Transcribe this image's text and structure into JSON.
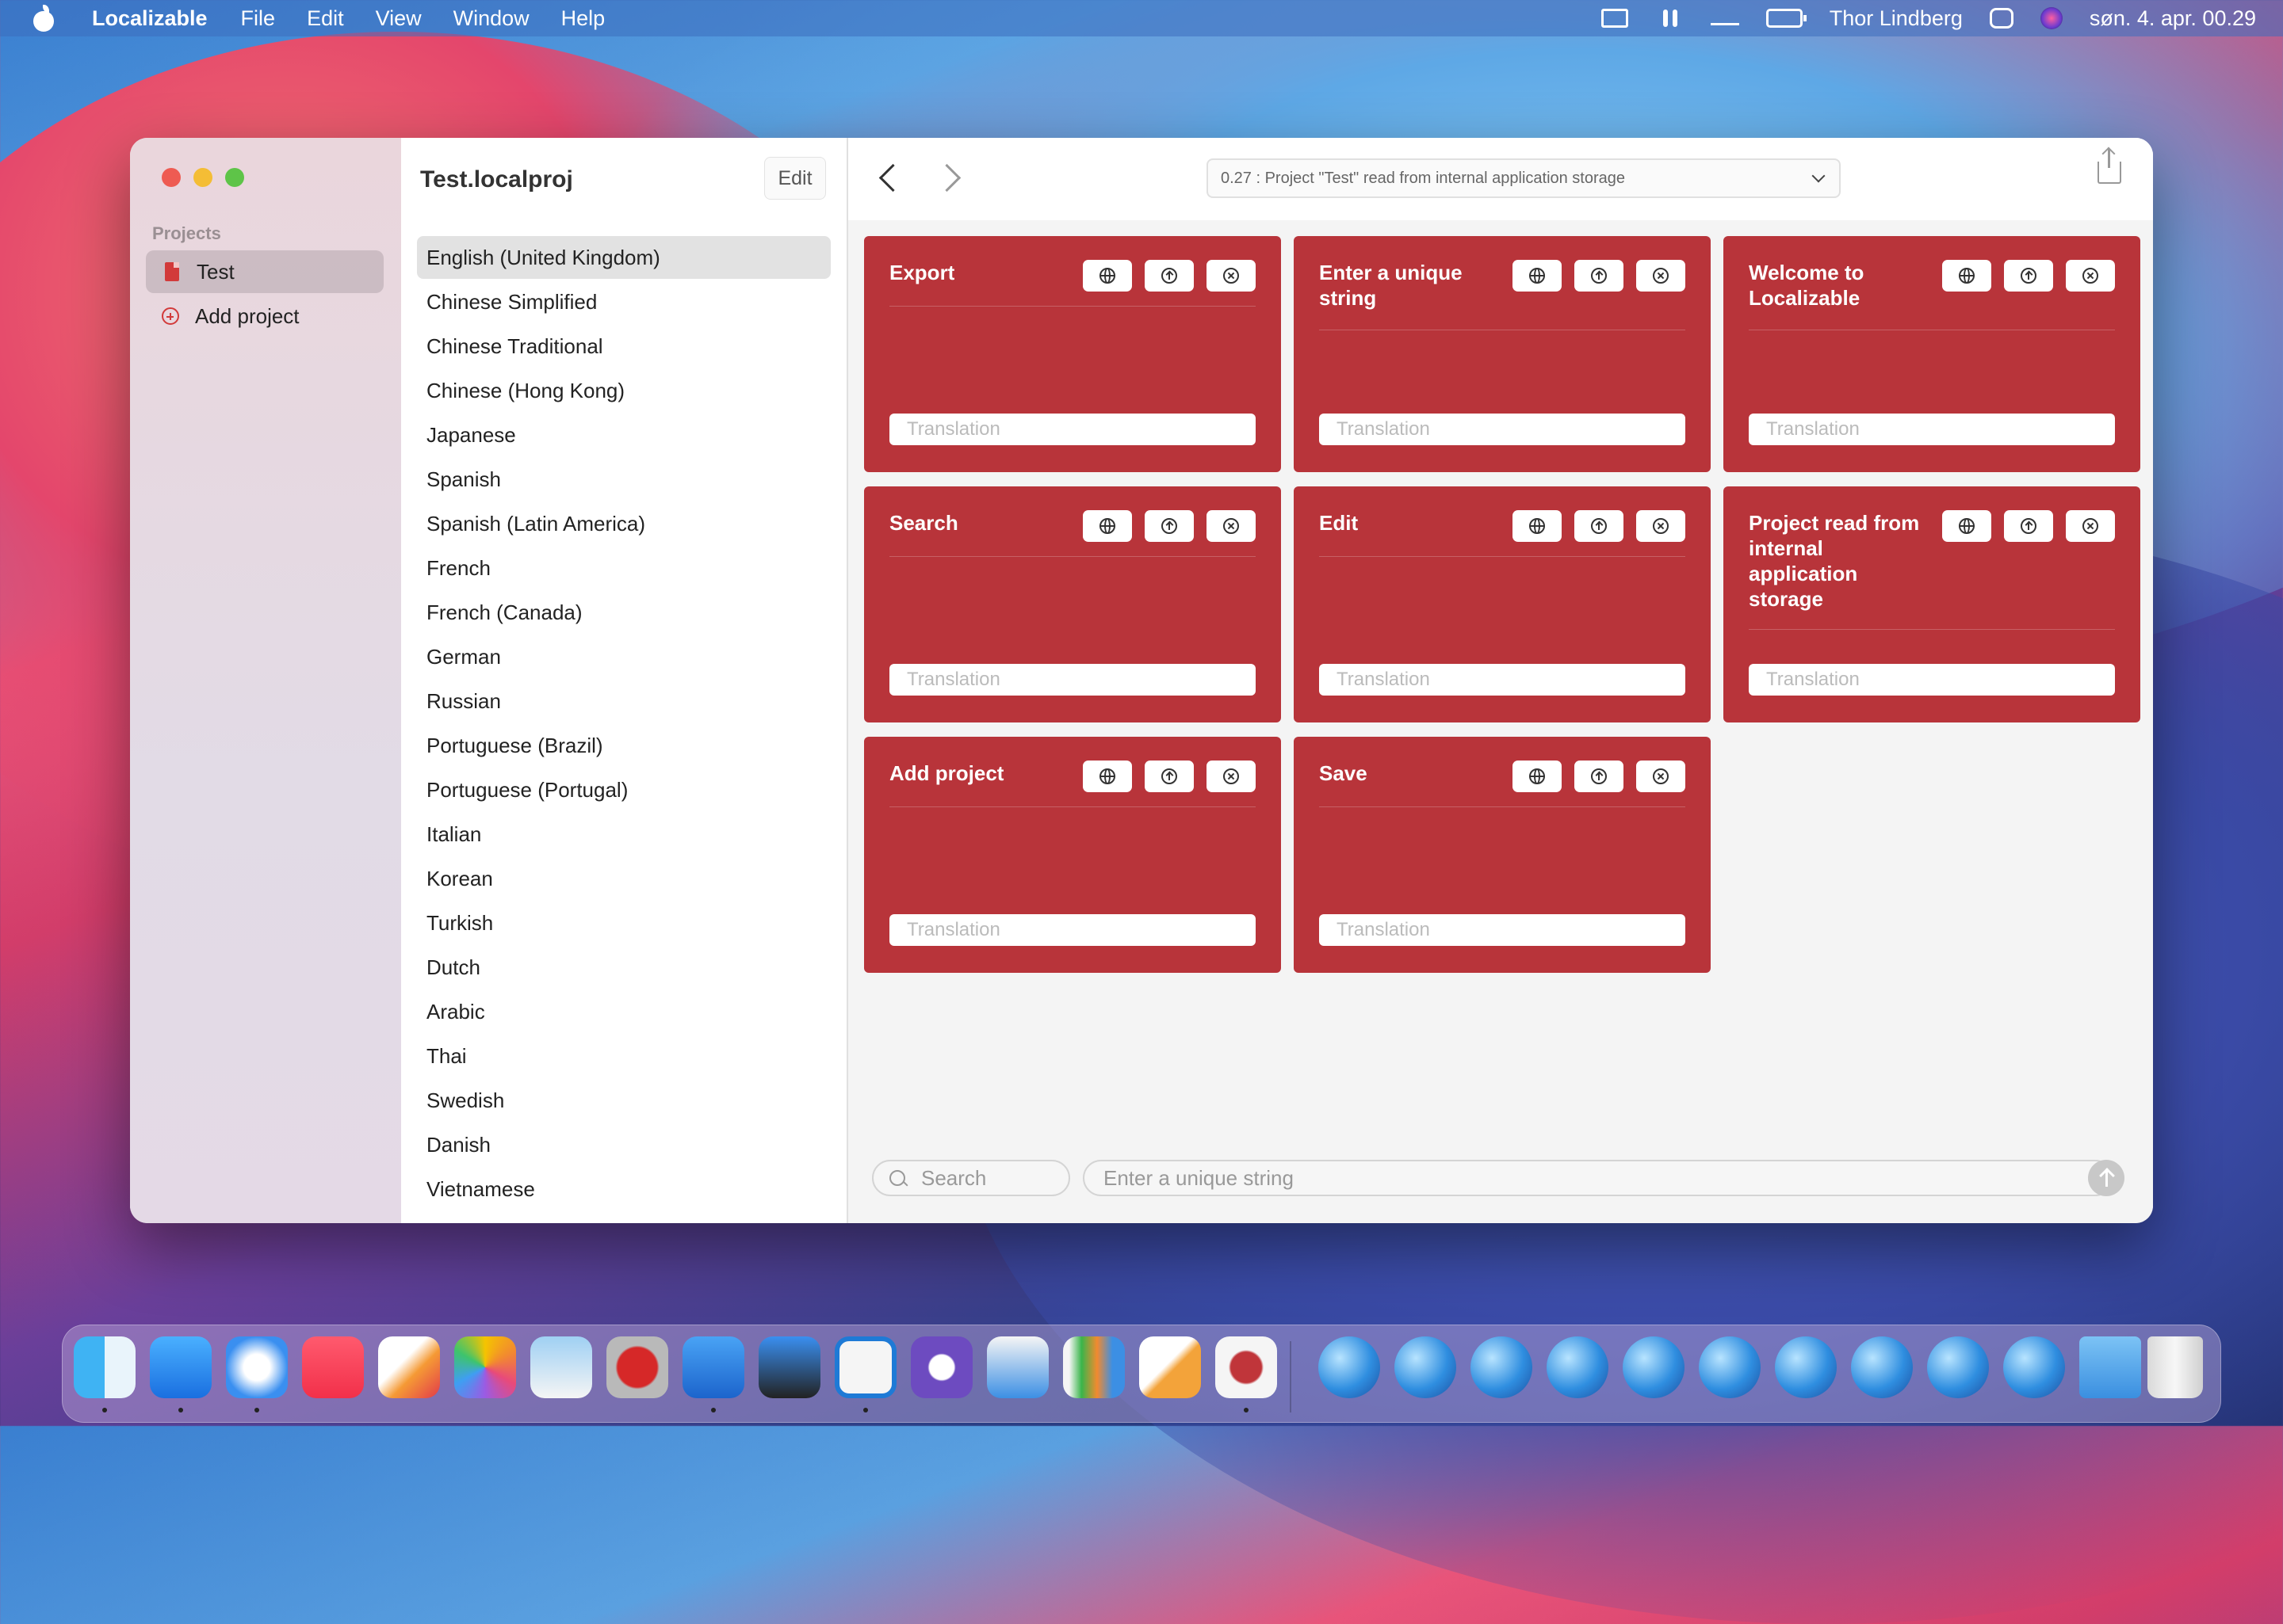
{
  "menubar": {
    "app_name": "Localizable",
    "menus": [
      "File",
      "Edit",
      "View",
      "Window",
      "Help"
    ],
    "user": "Thor Lindberg",
    "datetime": "søn. 4. apr.  00.29"
  },
  "sidebar": {
    "section": "Projects",
    "project": "Test",
    "add_project": "Add project"
  },
  "languages": {
    "title": "Test.localproj",
    "edit": "Edit",
    "items": [
      "English (United Kingdom)",
      "Chinese Simplified",
      "Chinese Traditional",
      "Chinese (Hong Kong)",
      "Japanese",
      "Spanish",
      "Spanish (Latin America)",
      "French",
      "French (Canada)",
      "German",
      "Russian",
      "Portuguese (Brazil)",
      "Portuguese (Portugal)",
      "Italian",
      "Korean",
      "Turkish",
      "Dutch",
      "Arabic",
      "Thai",
      "Swedish",
      "Danish",
      "Vietnamese"
    ],
    "selected": "English (United Kingdom)"
  },
  "toolbar": {
    "status": "0.27 : Project \"Test\" read from internal application storage"
  },
  "cards": [
    {
      "title": "Export",
      "placeholder": "Translation"
    },
    {
      "title": "Enter a unique string",
      "placeholder": "Translation"
    },
    {
      "title": "Welcome to Localizable",
      "placeholder": "Translation"
    },
    {
      "title": "Search",
      "placeholder": "Translation"
    },
    {
      "title": "Edit",
      "placeholder": "Translation"
    },
    {
      "title": "Project read from internal application storage",
      "placeholder": "Translation"
    },
    {
      "title": "Add project",
      "placeholder": "Translation"
    },
    {
      "title": "Save",
      "placeholder": "Translation"
    }
  ],
  "card_buttons": [
    "globe-icon",
    "arrow-up-circle-icon",
    "close-circle-icon"
  ],
  "bottombar": {
    "search_placeholder": "Search",
    "new_string_placeholder": "Enter a unique string"
  },
  "colors": {
    "card": "#b8343a",
    "accent": "#d23a3a"
  },
  "dock": {
    "apps": [
      "finder-icon",
      "mail-icon",
      "safari-icon",
      "music-icon",
      "pixelmator-icon",
      "photos-icon",
      "preview-icon",
      "stamp-icon",
      "xcode-icon",
      "instruments-icon",
      "vscode-icon",
      "github-icon",
      "keynote-icon",
      "numbers-icon",
      "pages-icon",
      "quote-app-icon"
    ],
    "stack_count": 10
  }
}
